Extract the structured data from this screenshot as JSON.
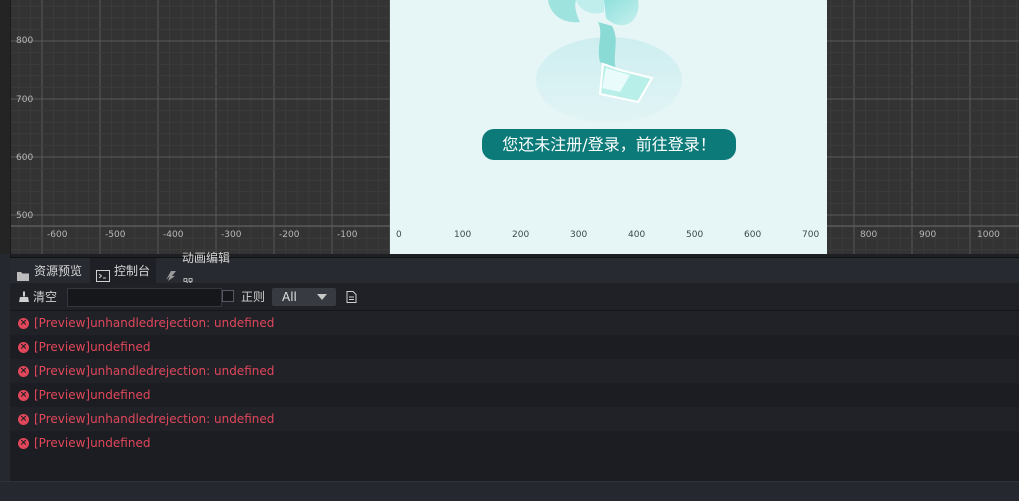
{
  "scene": {
    "ruler_y": [
      "800",
      "700",
      "600",
      "500"
    ],
    "ruler_x_left": [
      "-600",
      "-500",
      "-400",
      "-300",
      "-200",
      "-100"
    ],
    "ruler_x_canvas": [
      "0",
      "100",
      "200",
      "300",
      "400",
      "500",
      "600",
      "700"
    ],
    "ruler_x_right": [
      "800",
      "900",
      "1000"
    ],
    "canvas": {
      "login_prompt": "您还未注册/登录，前往登录！",
      "pill_color": "#0b7a78"
    }
  },
  "tabs": [
    {
      "label": "资源预览",
      "icon": "folder-icon"
    },
    {
      "label": "控制台",
      "icon": "terminal-icon"
    },
    {
      "label": "动画编辑器",
      "icon": "animation-icon"
    }
  ],
  "toolbar": {
    "clear_label": "清空",
    "search_value": "",
    "regex_label": "正则",
    "level_value": "All"
  },
  "logs": [
    {
      "text": "[Preview]unhandledrejection: undefined",
      "level": "error"
    },
    {
      "text": "[Preview]undefined",
      "level": "error"
    },
    {
      "text": "[Preview]unhandledrejection: undefined",
      "level": "error"
    },
    {
      "text": "[Preview]undefined",
      "level": "error"
    },
    {
      "text": "[Preview]unhandledrejection: undefined",
      "level": "error"
    },
    {
      "text": "[Preview]undefined",
      "level": "error"
    }
  ],
  "colors": {
    "error": "#e0475a",
    "accent": "#0b7a78"
  }
}
